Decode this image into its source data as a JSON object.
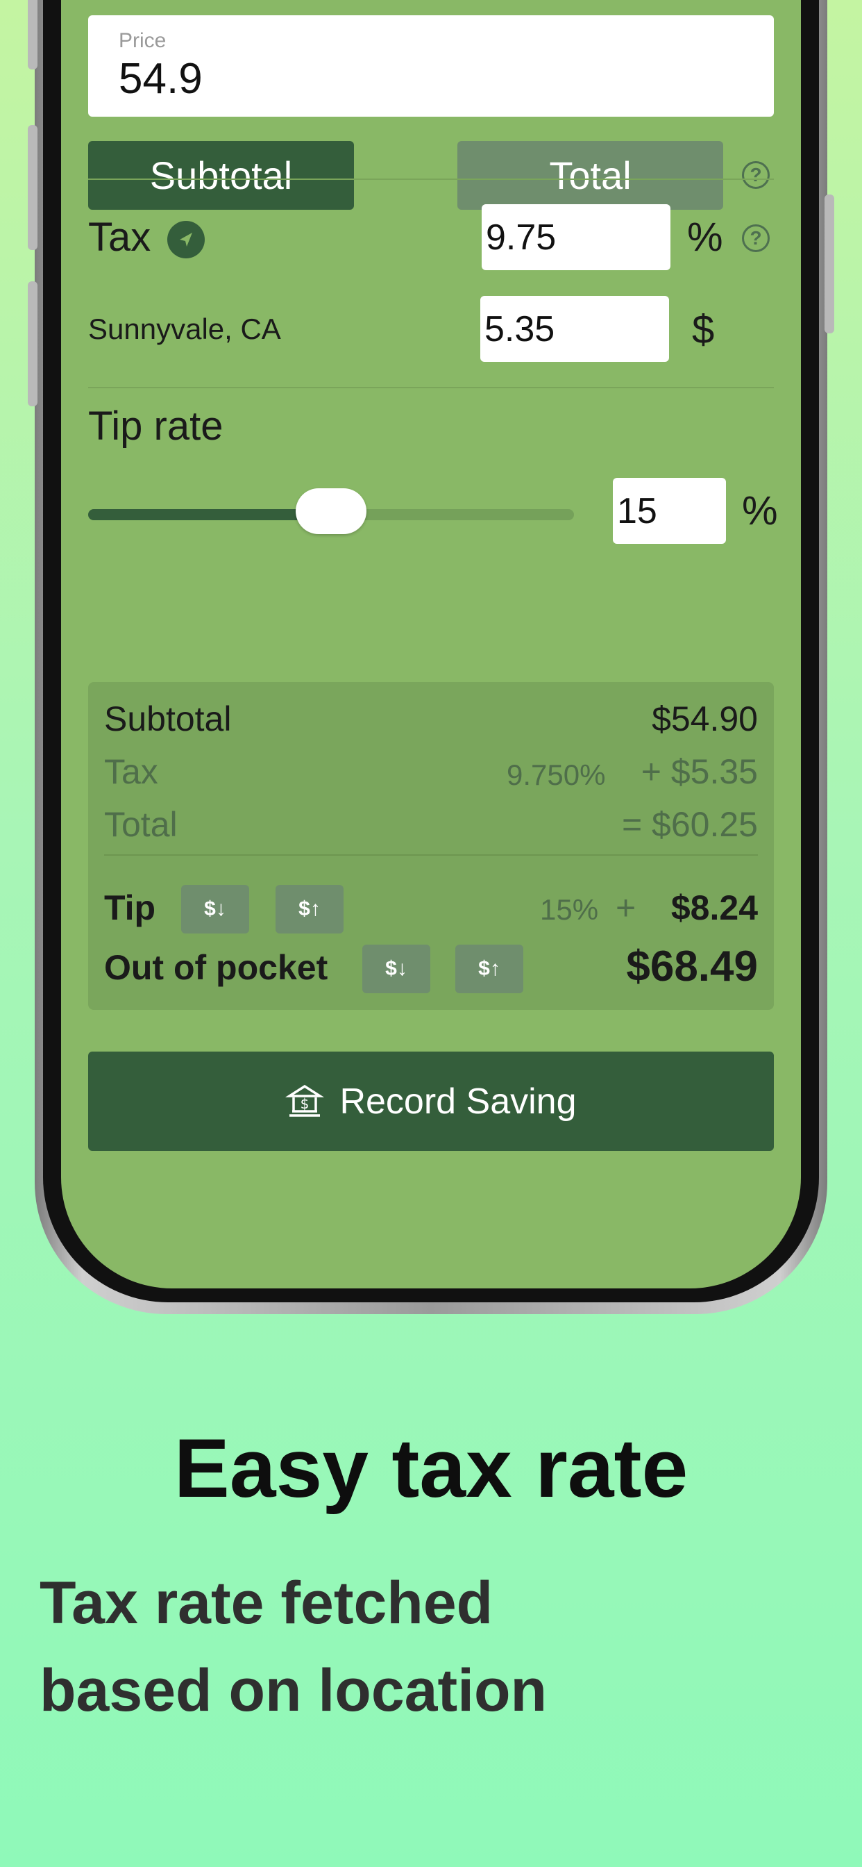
{
  "form": {
    "price_label": "Price",
    "price_value": "54.9",
    "mode_subtotal": "Subtotal",
    "mode_total": "Total"
  },
  "tax": {
    "label": "Tax",
    "location": "Sunnyvale, CA",
    "rate_value": "9.75",
    "rate_unit": "%",
    "amount_value": "5.35",
    "amount_unit": "$"
  },
  "tip": {
    "label": "Tip rate",
    "value": "15",
    "unit": "%",
    "slider_fraction": 0.5
  },
  "summary": {
    "subtotal_label": "Subtotal",
    "subtotal_value": "$54.90",
    "tax_label": "Tax",
    "tax_rate": "9.750%",
    "tax_value": "+ $5.35",
    "total_label": "Total",
    "total_value": "= $60.25",
    "tip_label": "Tip",
    "tip_rate": "15%",
    "tip_plus": "+",
    "tip_value": "$8.24",
    "oop_label": "Out of pocket",
    "oop_value": "$68.49",
    "round_down_icon_text": "$↓",
    "round_up_icon_text": "$↑"
  },
  "record_button": {
    "label": "Record Saving",
    "icon": "bank-icon"
  },
  "promo": {
    "headline": "Easy tax rate",
    "subline_1": "Tax rate fetched",
    "subline_2": "based on location"
  },
  "colors": {
    "accent": "#345e3b",
    "screen_bg": "#89b866"
  },
  "icons": [
    "help-icon",
    "location-arrow-icon",
    "bank-icon",
    "round-down-icon",
    "round-up-icon"
  ]
}
